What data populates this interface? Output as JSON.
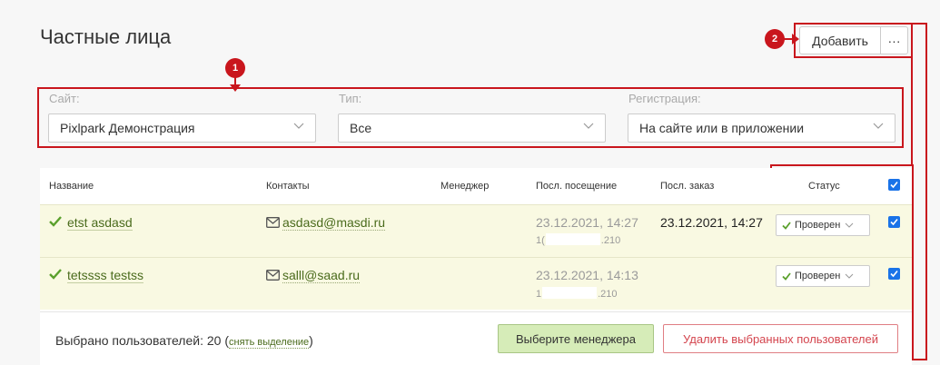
{
  "page": {
    "title": "Частные лица"
  },
  "toolbar": {
    "add_label": "Добавить",
    "more_label": "···"
  },
  "annotations": {
    "marker1": "1",
    "marker2": "2"
  },
  "filters": {
    "site": {
      "label": "Сайт:",
      "value": "Pixlpark Демонстрация"
    },
    "type": {
      "label": "Тип:",
      "value": "Все"
    },
    "registration": {
      "label": "Регистрация:",
      "value": "На сайте или в приложении"
    }
  },
  "table": {
    "columns": {
      "name": "Название",
      "contacts": "Контакты",
      "manager": "Менеджер",
      "last_visit": "Посл. посещение",
      "last_order": "Посл. заказ",
      "status": "Статус"
    },
    "rows": [
      {
        "name": "etst asdasd",
        "email": "asdasd@masdi.ru",
        "last_visit": "23.12.2021, 14:27",
        "ip_start": "1(",
        "ip_end": ".210",
        "last_order": "23.12.2021, 14:27",
        "status": "Проверен",
        "checked": true
      },
      {
        "name": "tetssss testss",
        "email": "salll@saad.ru",
        "last_visit": "23.12.2021, 14:13",
        "ip_start": "1",
        "ip_end": ".210",
        "last_order": "",
        "status": "Проверен",
        "checked": true
      }
    ]
  },
  "footer": {
    "selected_label": "Выбрано пользователей: 20",
    "unselect_label": "снять выделение",
    "choose_manager_label": "Выберите менеджера",
    "delete_label": "Удалить выбранных пользователей"
  },
  "colors": {
    "annotation": "#c9161d",
    "accent_green": "#5aa02c",
    "checkbox": "#1a73e8"
  }
}
